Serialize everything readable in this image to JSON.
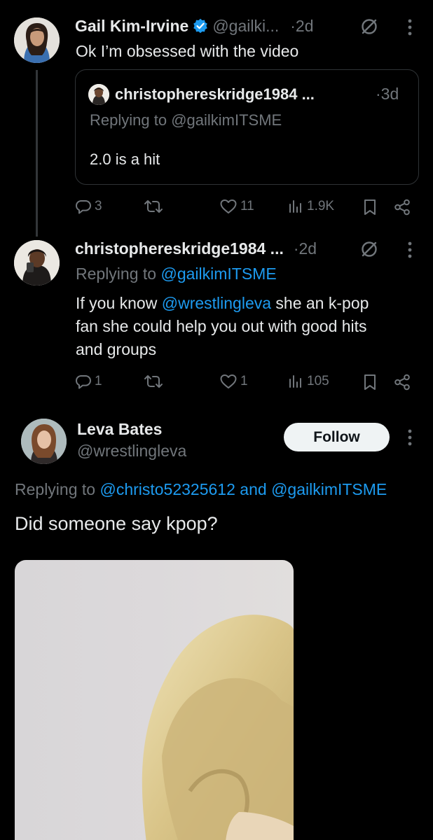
{
  "tweet1": {
    "author_name": "Gail Kim-Irvine",
    "handle": "@gailki...",
    "time": "·2d",
    "text": "Ok I’m obsessed with the video",
    "quote": {
      "author": "christophereskridge1984 ...",
      "time": "·3d",
      "replying_prefix": "Replying to",
      "replying_handle": "@gailkimITSME",
      "text": "2.0 is a hit"
    },
    "actions": {
      "replies": "3",
      "likes": "11",
      "views": "1.9K"
    }
  },
  "tweet2": {
    "author_name": "christophereskridge1984 ...",
    "time": "·2d",
    "replying_prefix": "Replying to",
    "replying_handle": "@gailkimITSME",
    "text_pre": "If you know",
    "mention": "@wrestlingleva",
    "text_line1_post": "she an k-pop",
    "text_line2": "fan she could help you out with good hits",
    "text_line3": "and groups",
    "actions": {
      "replies": "1",
      "likes": "1",
      "views": "105"
    }
  },
  "main_tweet": {
    "author_name": "Leva Bates",
    "handle": "@wrestlingleva",
    "follow_label": "Follow",
    "replying_prefix": "Replying to",
    "replying_handle1": "@christo52325612",
    "replying_and": "and",
    "replying_handle2": "@gailkimITSME",
    "text": "Did someone say kpop?"
  },
  "icons": {
    "reply": "reply-icon",
    "retweet": "retweet-icon",
    "like": "heart-icon",
    "views": "views-icon",
    "bookmark": "bookmark-icon",
    "share": "share-icon",
    "grok": "grok-icon",
    "more": "more-icon",
    "verified": "verified-badge-icon"
  },
  "colors": {
    "background": "#000000",
    "link": "#1d9bf0",
    "muted": "#71767b",
    "verified": "#1d9bf0"
  }
}
